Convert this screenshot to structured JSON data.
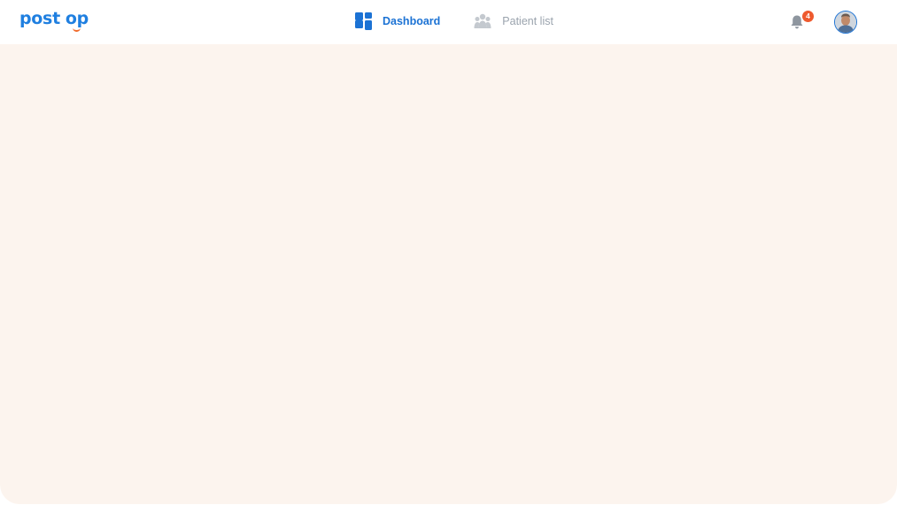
{
  "logo": {
    "word1": "post",
    "word2": "op",
    "colors": {
      "primary": "#1f7fe0",
      "smile": "#f06a2a"
    }
  },
  "nav": {
    "items": [
      {
        "label": "Dashboard",
        "icon": "dashboard-grid-icon",
        "active": true
      },
      {
        "label": "Patient list",
        "icon": "people-icon",
        "active": false
      }
    ]
  },
  "notifications": {
    "icon": "bell-icon",
    "count": "4"
  },
  "user": {
    "avatar": "user-avatar"
  },
  "colors": {
    "accent": "#1b72d4",
    "inactive": "#9aa3ad",
    "badge": "#ee5a2e",
    "content_background": "#fcf4ee"
  }
}
